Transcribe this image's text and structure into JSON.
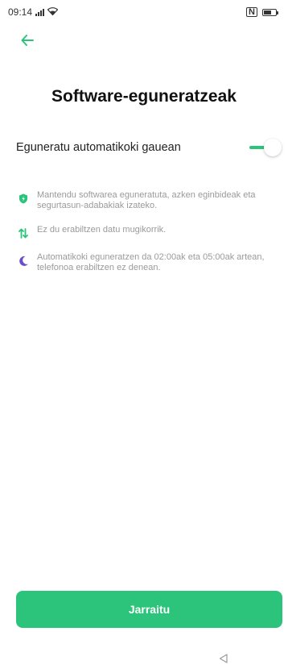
{
  "status_bar": {
    "time": "09:14",
    "nfc_label": "N"
  },
  "colors": {
    "accent": "#2bc47a",
    "shield": "#2bc47a",
    "moon": "#6a4ccf"
  },
  "header": {
    "back_icon": "arrow-left-icon"
  },
  "title": "Software-eguneratzeak",
  "auto_update": {
    "label": "Eguneratu automatikoki gauean",
    "enabled": true
  },
  "info_items": [
    {
      "icon": "shield-icon",
      "text": "Mantendu softwarea eguneratuta, azken eginbideak eta segurtasun-adabakiak izateko."
    },
    {
      "icon": "data-arrows-icon",
      "text": "Ez du erabiltzen datu mugikorrik."
    },
    {
      "icon": "moon-icon",
      "text": "Automatikoki eguneratzen da 02:00ak eta 05:00ak artean, telefonoa erabiltzen ez denean."
    }
  ],
  "continue_button": {
    "label": "Jarraitu"
  },
  "nav_bar": {
    "back_icon": "triangle-back-icon"
  }
}
